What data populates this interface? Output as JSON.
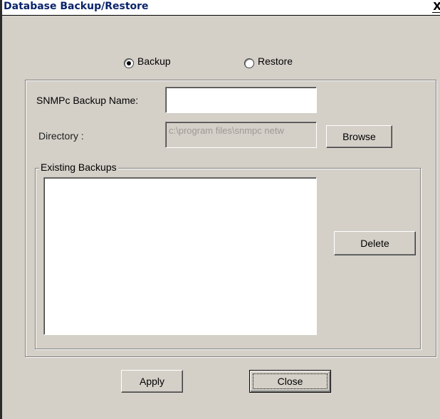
{
  "window": {
    "title": "Database Backup/Restore",
    "close_glyph": "X"
  },
  "mode": {
    "options": [
      {
        "label": "Backup",
        "checked": true
      },
      {
        "label": "Restore",
        "checked": false
      }
    ]
  },
  "form": {
    "backup_name_label": "SNMPc Backup Name:",
    "backup_name_value": "",
    "directory_label": "Directory :",
    "directory_value": "c:\\program files\\snmpc netw",
    "browse_label": "Browse"
  },
  "existing_backups": {
    "legend": "Existing Backups",
    "items": [],
    "delete_label": "Delete"
  },
  "footer": {
    "apply_label": "Apply",
    "close_label": "Close"
  }
}
